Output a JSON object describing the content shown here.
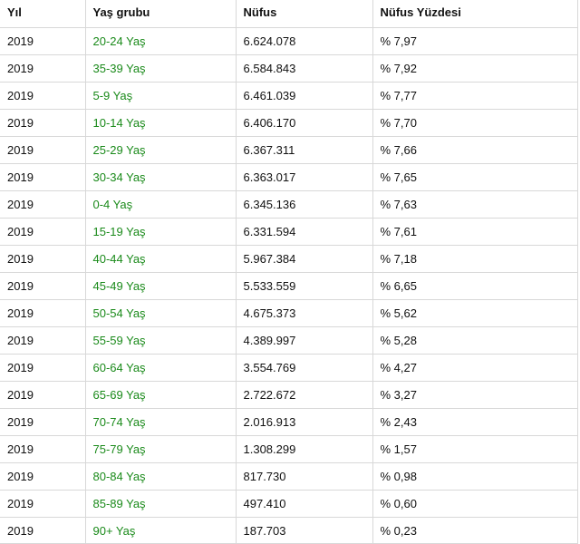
{
  "table": {
    "headers": [
      "Yıl",
      "Yaş grubu",
      "Nüfus",
      "Nüfus Yüzdesi"
    ],
    "rows": [
      {
        "year": "2019",
        "age": "20-24 Yaş",
        "pop": "6.624.078",
        "pct": "% 7,97"
      },
      {
        "year": "2019",
        "age": "35-39 Yaş",
        "pop": "6.584.843",
        "pct": "% 7,92"
      },
      {
        "year": "2019",
        "age": "5-9 Yaş",
        "pop": "6.461.039",
        "pct": "% 7,77"
      },
      {
        "year": "2019",
        "age": "10-14 Yaş",
        "pop": "6.406.170",
        "pct": "% 7,70"
      },
      {
        "year": "2019",
        "age": "25-29 Yaş",
        "pop": "6.367.311",
        "pct": "% 7,66"
      },
      {
        "year": "2019",
        "age": "30-34 Yaş",
        "pop": "6.363.017",
        "pct": "% 7,65"
      },
      {
        "year": "2019",
        "age": "0-4 Yaş",
        "pop": "6.345.136",
        "pct": "% 7,63"
      },
      {
        "year": "2019",
        "age": "15-19 Yaş",
        "pop": "6.331.594",
        "pct": "% 7,61"
      },
      {
        "year": "2019",
        "age": "40-44 Yaş",
        "pop": "5.967.384",
        "pct": "% 7,18"
      },
      {
        "year": "2019",
        "age": "45-49 Yaş",
        "pop": "5.533.559",
        "pct": "% 6,65"
      },
      {
        "year": "2019",
        "age": "50-54 Yaş",
        "pop": "4.675.373",
        "pct": "% 5,62"
      },
      {
        "year": "2019",
        "age": "55-59 Yaş",
        "pop": "4.389.997",
        "pct": "% 5,28"
      },
      {
        "year": "2019",
        "age": "60-64 Yaş",
        "pop": "3.554.769",
        "pct": "% 4,27"
      },
      {
        "year": "2019",
        "age": "65-69 Yaş",
        "pop": "2.722.672",
        "pct": "% 3,27"
      },
      {
        "year": "2019",
        "age": "70-74 Yaş",
        "pop": "2.016.913",
        "pct": "% 2,43"
      },
      {
        "year": "2019",
        "age": "75-79 Yaş",
        "pop": "1.308.299",
        "pct": "% 1,57"
      },
      {
        "year": "2019",
        "age": "80-84 Yaş",
        "pop": "817.730",
        "pct": "% 0,98"
      },
      {
        "year": "2019",
        "age": "85-89 Yaş",
        "pop": "497.410",
        "pct": "% 0,60"
      },
      {
        "year": "2019",
        "age": "90+ Yaş",
        "pop": "187.703",
        "pct": "% 0,23"
      }
    ]
  },
  "colors": {
    "age_group_text": "#1a8a1a",
    "border": "#d8d8d8"
  }
}
